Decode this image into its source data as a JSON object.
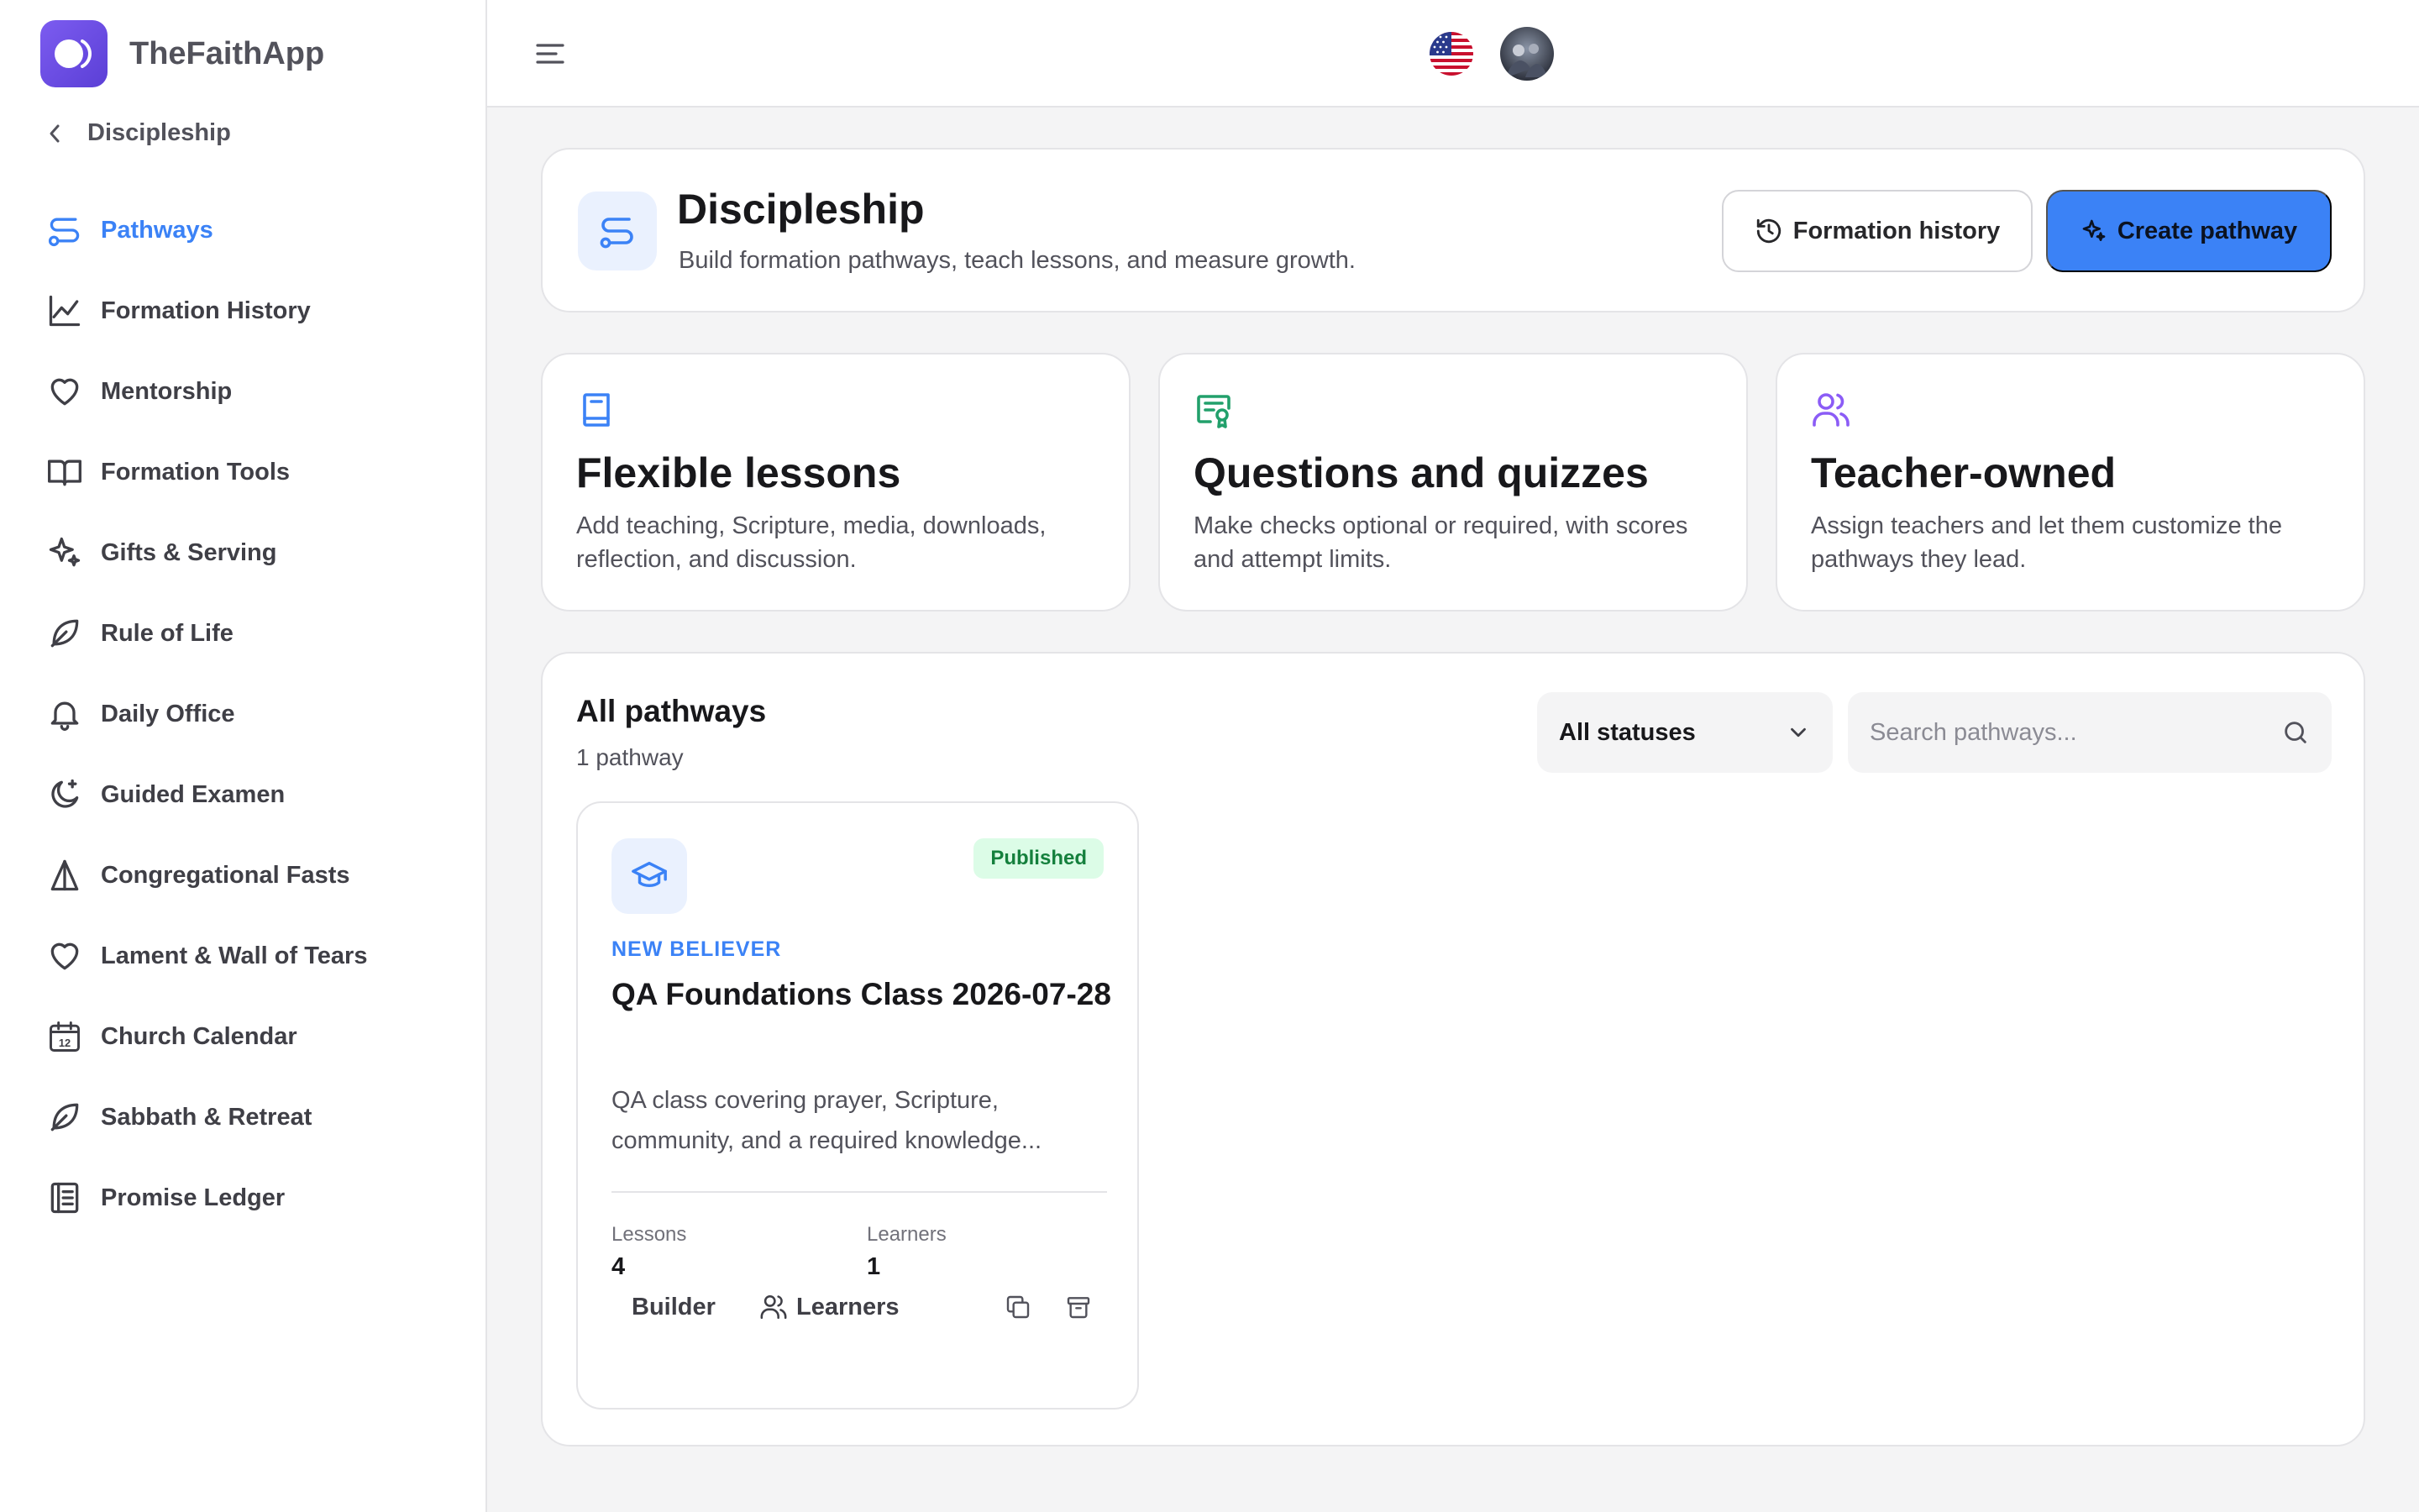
{
  "app": {
    "name": "TheFaithApp"
  },
  "sidebar": {
    "back_label": "Discipleship",
    "items": [
      {
        "label": "Pathways",
        "icon": "route-icon",
        "active": true
      },
      {
        "label": "Formation History",
        "icon": "line-chart-icon"
      },
      {
        "label": "Mentorship",
        "icon": "heart-icon"
      },
      {
        "label": "Formation Tools",
        "icon": "book-open-icon"
      },
      {
        "label": "Gifts & Serving",
        "icon": "sparkles-icon"
      },
      {
        "label": "Rule of Life",
        "icon": "leaf-icon"
      },
      {
        "label": "Daily Office",
        "icon": "bell-icon"
      },
      {
        "label": "Guided Examen",
        "icon": "moon-star-icon"
      },
      {
        "label": "Congregational Fasts",
        "icon": "praying-hands-icon"
      },
      {
        "label": "Lament & Wall of Tears",
        "icon": "heart-icon"
      },
      {
        "label": "Church Calendar",
        "icon": "calendar-icon"
      },
      {
        "label": "Sabbath & Retreat",
        "icon": "leaf-icon"
      },
      {
        "label": "Promise Ledger",
        "icon": "ledger-icon"
      }
    ]
  },
  "topbar": {
    "language_flag": "us-flag-icon"
  },
  "header": {
    "title": "Discipleship",
    "subtitle": "Build formation pathways, teach lessons, and measure growth.",
    "history_button": "Formation history",
    "create_button": "Create pathway"
  },
  "features": [
    {
      "title": "Flexible lessons",
      "description": "Add teaching, Scripture, media, downloads, reflection, and discussion.",
      "icon": "book-icon",
      "color": "#3b82f6"
    },
    {
      "title": "Questions and quizzes",
      "description": "Make checks optional or required, with scores and attempt limits.",
      "icon": "certificate-icon",
      "color": "#22a06b"
    },
    {
      "title": "Teacher-owned",
      "description": "Assign teachers and let them customize the pathways they lead.",
      "icon": "users-icon",
      "color": "#8b5cf6"
    }
  ],
  "pathways": {
    "title": "All pathways",
    "count_label": "1 pathway",
    "status_filter": "All statuses",
    "search_placeholder": "Search pathways...",
    "items": [
      {
        "status": "Published",
        "category": "NEW BELIEVER",
        "title": "QA Foundations Class 2026-07-28",
        "description": "QA class covering prayer, Scripture, community, and a required knowledge...",
        "lessons_label": "Lessons",
        "lessons": "4",
        "learners_label": "Learners",
        "learners": "1",
        "builder_button": "Builder",
        "learners_button": "Learners"
      }
    ]
  },
  "colors": {
    "accent": "#3b82f6",
    "published_bg": "#dcfce7",
    "published_text": "#15803d"
  }
}
